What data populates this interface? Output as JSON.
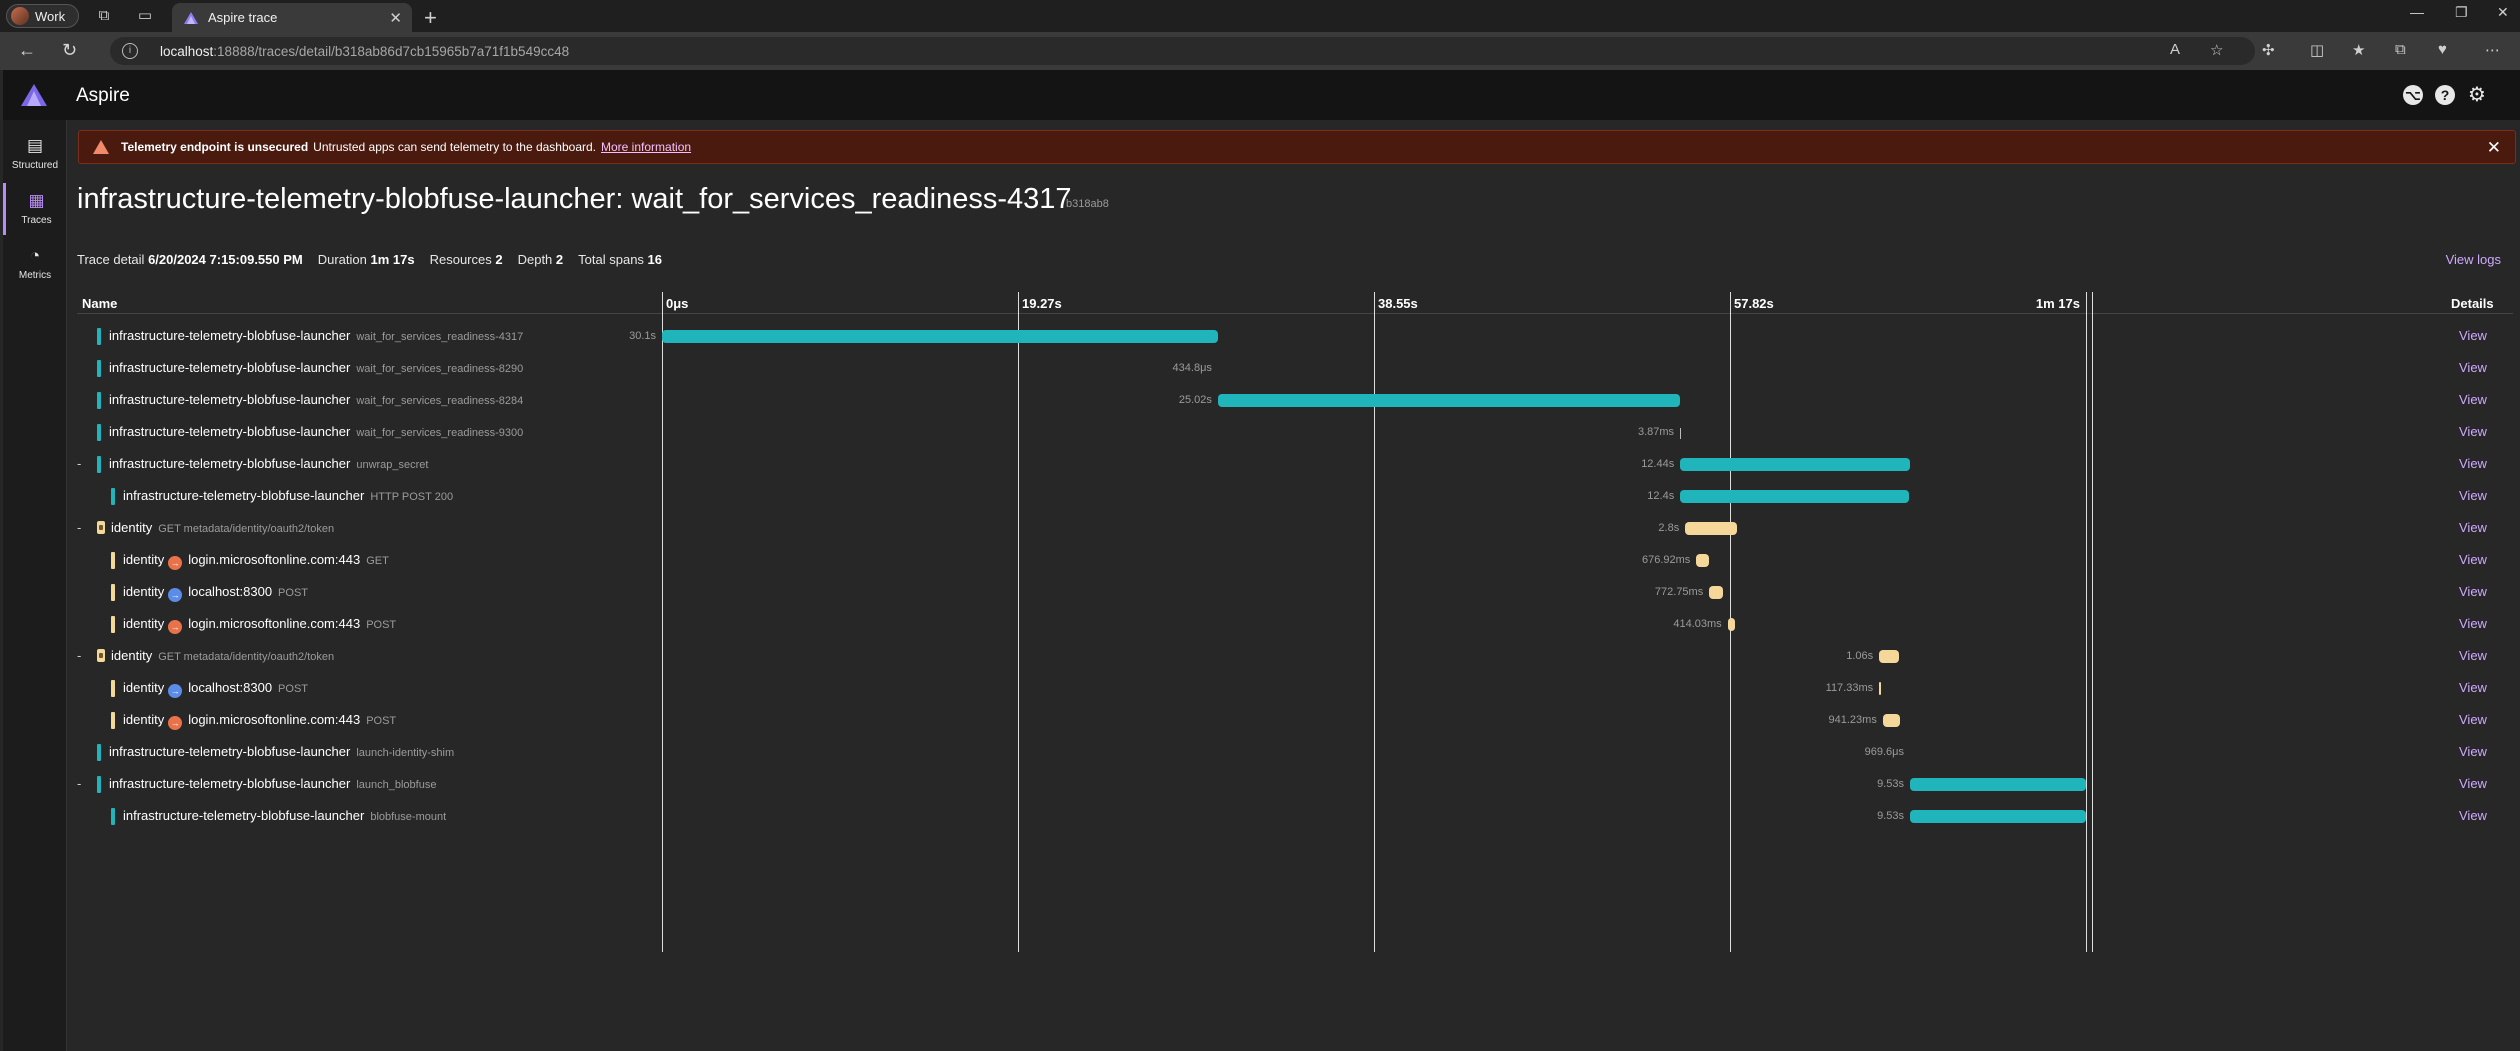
{
  "browser": {
    "profile_label": "Work",
    "tab_title": "Aspire trace",
    "url_host": "localhost",
    "url_path": ":18888/traces/detail/b318ab86d7cb15965b7a71f1b549cc48"
  },
  "app": {
    "title": "Aspire",
    "sidebar": [
      {
        "label": "Structured",
        "icon": "structured-logs-icon"
      },
      {
        "label": "Traces",
        "icon": "traces-icon",
        "active": true
      },
      {
        "label": "Metrics",
        "icon": "metrics-icon"
      }
    ]
  },
  "banner": {
    "title": "Telemetry endpoint is unsecured",
    "message": "Untrusted apps can send telemetry to the dashboard.",
    "link": "More information"
  },
  "page": {
    "title": "infrastructure-telemetry-blobfuse-launcher: wait_for_services_readiness-4317",
    "trace_id_short": "b318ab8",
    "meta": {
      "trace_detail_label": "Trace detail",
      "trace_detail_value": "6/20/2024 7:15:09.550 PM",
      "duration_label": "Duration",
      "duration_value": "1m 17s",
      "resources_label": "Resources",
      "resources_value": "2",
      "depth_label": "Depth",
      "depth_value": "2",
      "total_spans_label": "Total spans",
      "total_spans_value": "16"
    },
    "view_logs": "View logs"
  },
  "grid": {
    "name_header": "Name",
    "details_header": "Details",
    "ticks": [
      "0μs",
      "19.27s",
      "38.55s",
      "57.82s",
      "1m 17s"
    ],
    "total_seconds": 77.1,
    "colors": {
      "launcher": "#1fb5ba",
      "identity": "#f6d79a",
      "outbound": "#e8734a",
      "internal": "#5b8de8"
    },
    "rows": [
      {
        "expander": "",
        "indent": 0,
        "color": "launcher",
        "service": "infrastructure-telemetry-blobfuse-launcher",
        "peer": "",
        "peer_icon": "",
        "op": "wait_for_services_readiness-4317",
        "start": 0.0,
        "duration_s": 30.1,
        "duration": "30.1s",
        "view": "View"
      },
      {
        "expander": "",
        "indent": 0,
        "color": "launcher",
        "service": "infrastructure-telemetry-blobfuse-launcher",
        "peer": "",
        "peer_icon": "",
        "op": "wait_for_services_readiness-8290",
        "start": 30.1,
        "duration_s": 0.0004,
        "duration": "434.8μs",
        "view": "View"
      },
      {
        "expander": "",
        "indent": 0,
        "color": "launcher",
        "service": "infrastructure-telemetry-blobfuse-launcher",
        "peer": "",
        "peer_icon": "",
        "op": "wait_for_services_readiness-8284",
        "start": 30.1,
        "duration_s": 25.02,
        "duration": "25.02s",
        "view": "View"
      },
      {
        "expander": "",
        "indent": 0,
        "color": "launcher",
        "service": "infrastructure-telemetry-blobfuse-launcher",
        "peer": "",
        "peer_icon": "",
        "op": "wait_for_services_readiness-9300",
        "start": 55.12,
        "duration_s": 0.004,
        "duration": "3.87ms",
        "view": "View"
      },
      {
        "expander": "-",
        "indent": 0,
        "color": "launcher",
        "service": "infrastructure-telemetry-blobfuse-launcher",
        "peer": "",
        "peer_icon": "",
        "op": "unwrap_secret",
        "start": 55.13,
        "duration_s": 12.44,
        "duration": "12.44s",
        "view": "View"
      },
      {
        "expander": "",
        "indent": 1,
        "color": "launcher",
        "service": "infrastructure-telemetry-blobfuse-launcher",
        "peer": "",
        "peer_icon": "",
        "op": "HTTP POST 200",
        "start": 55.13,
        "duration_s": 12.4,
        "duration": "12.4s",
        "view": "View"
      },
      {
        "expander": "-",
        "indent": 0,
        "color": "identity",
        "service": "identity",
        "peer": "",
        "peer_icon": "",
        "op": "GET metadata/identity/oauth2/token",
        "start": 55.4,
        "duration_s": 2.8,
        "duration": "2.8s",
        "view": "View"
      },
      {
        "expander": "",
        "indent": 1,
        "color": "identity",
        "service": "identity",
        "peer": "login.microsoftonline.com:443",
        "peer_icon": "outbound",
        "op": "GET",
        "start": 56.0,
        "duration_s": 0.68,
        "duration": "676.92ms",
        "view": "View"
      },
      {
        "expander": "",
        "indent": 1,
        "color": "identity",
        "service": "identity",
        "peer": "localhost:8300",
        "peer_icon": "internal",
        "op": "POST",
        "start": 56.7,
        "duration_s": 0.77,
        "duration": "772.75ms",
        "view": "View"
      },
      {
        "expander": "",
        "indent": 1,
        "color": "identity",
        "service": "identity",
        "peer": "login.microsoftonline.com:443",
        "peer_icon": "outbound",
        "op": "POST",
        "start": 57.7,
        "duration_s": 0.41,
        "duration": "414.03ms",
        "view": "View"
      },
      {
        "expander": "-",
        "indent": 0,
        "color": "identity",
        "service": "identity",
        "peer": "",
        "peer_icon": "",
        "op": "GET metadata/identity/oauth2/token",
        "start": 65.9,
        "duration_s": 1.06,
        "duration": "1.06s",
        "view": "View"
      },
      {
        "expander": "",
        "indent": 1,
        "color": "identity",
        "service": "identity",
        "peer": "localhost:8300",
        "peer_icon": "internal",
        "op": "POST",
        "start": 65.9,
        "duration_s": 0.12,
        "duration": "117.33ms",
        "view": "View"
      },
      {
        "expander": "",
        "indent": 1,
        "color": "identity",
        "service": "identity",
        "peer": "login.microsoftonline.com:443",
        "peer_icon": "outbound",
        "op": "POST",
        "start": 66.1,
        "duration_s": 0.94,
        "duration": "941.23ms",
        "view": "View"
      },
      {
        "expander": "",
        "indent": 0,
        "color": "launcher",
        "service": "infrastructure-telemetry-blobfuse-launcher",
        "peer": "",
        "peer_icon": "",
        "op": "launch-identity-shim",
        "start": 67.57,
        "duration_s": 0.001,
        "duration": "969.6μs",
        "view": "View"
      },
      {
        "expander": "-",
        "indent": 0,
        "color": "launcher",
        "service": "infrastructure-telemetry-blobfuse-launcher",
        "peer": "",
        "peer_icon": "",
        "op": "launch_blobfuse",
        "start": 67.57,
        "duration_s": 9.53,
        "duration": "9.53s",
        "view": "View"
      },
      {
        "expander": "",
        "indent": 1,
        "color": "launcher",
        "service": "infrastructure-telemetry-blobfuse-launcher",
        "peer": "",
        "peer_icon": "",
        "op": "blobfuse-mount",
        "start": 67.57,
        "duration_s": 9.53,
        "duration": "9.53s",
        "view": "View"
      }
    ]
  }
}
